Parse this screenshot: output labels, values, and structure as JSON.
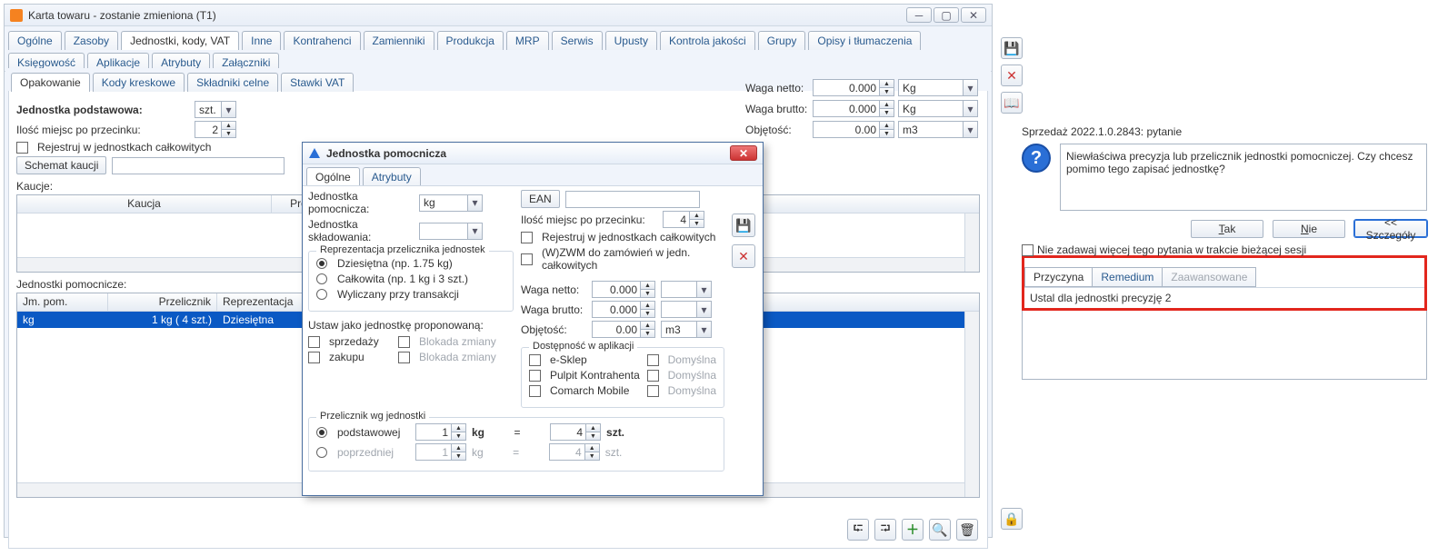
{
  "window": {
    "title": "Karta towaru - zostanie zmieniona (T1)",
    "tabs": [
      "Ogólne",
      "Zasoby",
      "Jednostki, kody, VAT",
      "Inne",
      "Kontrahenci",
      "Zamienniki",
      "Produkcja",
      "MRP",
      "Serwis",
      "Upusty",
      "Kontrola jakości",
      "Grupy",
      "Opisy i tłumaczenia",
      "Księgowość",
      "Aplikacje",
      "Atrybuty",
      "Załączniki"
    ],
    "active_tab": 2,
    "subtabs": [
      "Opakowanie",
      "Kody kreskowe",
      "Składniki celne",
      "Stawki VAT"
    ],
    "active_subtab": 0
  },
  "main": {
    "base_unit_label": "Jednostka podstawowa:",
    "base_unit_value": "szt.",
    "decimals_label": "Ilość miejsc po przecinku:",
    "decimals_value": "2",
    "register_int_label": "Rejestruj w jednostkach całkowitych",
    "deposit_btn": "Schemat kaucji",
    "deposits_label": "Kaucje:",
    "grid1_cols": [
      "Kaucja",
      "Prd"
    ],
    "aux_label": "Jednostki pomocnicze:",
    "grid2_cols": [
      "Jm. pom.",
      "Przelicznik",
      "Reprezentacja"
    ],
    "grid2_row": {
      "unit": "kg",
      "conv": "1 kg (      4 szt.)",
      "rep": "Dziesiętna"
    }
  },
  "weights": {
    "net_label": "Waga netto:",
    "net_val": "0.000",
    "net_unit": "Kg",
    "gross_label": "Waga brutto:",
    "gross_val": "0.000",
    "gross_unit": "Kg",
    "vol_label": "Objętość:",
    "vol_val": "0.00",
    "vol_unit": "m3"
  },
  "modal": {
    "title": "Jednostka pomocnicza",
    "tabs": [
      "Ogólne",
      "Atrybuty"
    ],
    "aux_unit_label": "Jednostka pomocnicza:",
    "aux_unit_val": "kg",
    "store_unit_label": "Jednostka składowania:",
    "ean_btn": "EAN",
    "decimals_label": "Ilość miejsc po przecinku:",
    "decimals_val": "4",
    "reg_int": "Rejestruj w jednostkach całkowitych",
    "wzwm": "(W)ZWM do zamówień w jedn. całkowitych",
    "rep_legend": "Reprezentacja przelicznika jednostek",
    "rep_opts": [
      "Dziesiętna (np. 1.75 kg)",
      "Całkowita (np. 1 kg i 3 szt.)",
      "Wyliczany przy transakcji"
    ],
    "propose_legend": "Ustaw jako jednostkę proponowaną:",
    "propose_sale": "sprzedaży",
    "propose_buy": "zakupu",
    "block": "Blokada zmiany",
    "w_net": "Waga netto:",
    "w_gross": "Waga brutto:",
    "w_vol": "Objętość:",
    "w_net_val": "0.000",
    "w_gross_val": "0.000",
    "w_vol_val": "0.00",
    "w_vol_unit": "m3",
    "avail_legend": "Dostępność w aplikacji",
    "avail_opts": [
      "e-Sklep",
      "Pulpit Kontrahenta",
      "Comarch Mobile"
    ],
    "avail_def": "Domyślna",
    "conv_legend": "Przelicznik wg jednostki",
    "conv_base": "podstawowej",
    "conv_prev": "poprzedniej",
    "conv_a": "1",
    "conv_a_unit": "kg",
    "conv_eq": "=",
    "conv_b": "4",
    "conv_b_unit": "szt."
  },
  "dlg2": {
    "title": "Sprzedaż 2022.1.0.2843: pytanie",
    "msg": "Niewłaściwa precyzja lub przelicznik jednostki pomocniczej. Czy chcesz pomimo tego zapisać jednostkę?",
    "yes": "Tak",
    "no": "Nie",
    "details": "<< Szczegóły",
    "dont_ask": "Nie zadawaj więcej tego pytania w trakcie bieżącej sesji",
    "tabs": [
      "Przyczyna",
      "Remedium",
      "Zaawansowane"
    ],
    "hint": "Ustal dla jednostki precyzję 2"
  }
}
